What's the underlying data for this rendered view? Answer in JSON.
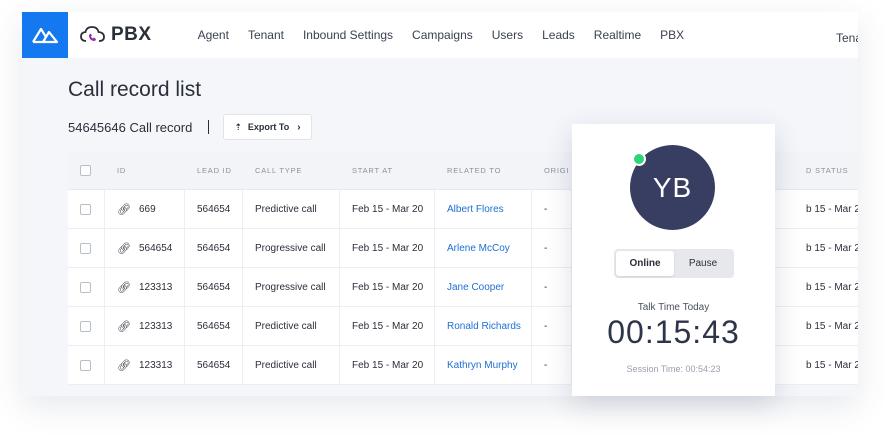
{
  "app": {
    "name": "PBX",
    "logo_icon": "triangle-mark-icon",
    "brand_icon": "cloud-phone-icon",
    "accent": "#1478f0"
  },
  "nav": {
    "items": [
      "Agent",
      "Tenant",
      "Inbound Settings",
      "Campaigns",
      "Users",
      "Leads",
      "Realtime",
      "PBX"
    ],
    "overflow_item": "Tena"
  },
  "page": {
    "title": "Call record list",
    "subtitle": "54645646 Call record",
    "export_label": "Export To"
  },
  "table": {
    "columns": [
      "ID",
      "LEAD ID",
      "CALL TYPE",
      "START AT",
      "RELATED TO",
      "ORIGI"
    ],
    "end_column": "D STATUS",
    "rows": [
      {
        "id": "669",
        "lead_id": "564654",
        "call_type": "Predictive call",
        "start_at": "Feb 15 - Mar 20",
        "related_to": "Albert Flores",
        "origin": "-",
        "end": "b 15 - Mar 20"
      },
      {
        "id": "564654",
        "lead_id": "564654",
        "call_type": "Progressive call",
        "start_at": "Feb 15 - Mar 20",
        "related_to": "Arlene McCoy",
        "origin": "-",
        "end": "b 15 - Mar 20"
      },
      {
        "id": "123313",
        "lead_id": "564654",
        "call_type": "Progressive call",
        "start_at": "Feb 15 - Mar 20",
        "related_to": "Jane Cooper",
        "origin": "-",
        "end": "b 15 - Mar 20"
      },
      {
        "id": "123313",
        "lead_id": "564654",
        "call_type": "Predictive call",
        "start_at": "Feb 15 - Mar 20",
        "related_to": "Ronald Richards",
        "origin": "-",
        "end": "b 15 - Mar 20"
      },
      {
        "id": "123313",
        "lead_id": "564654",
        "call_type": "Predictive call",
        "start_at": "Feb 15 - Mar 20",
        "related_to": "Kathryn Murphy",
        "origin": "-",
        "end": "b 15 - Mar 20"
      }
    ]
  },
  "agent_card": {
    "initials": "YB",
    "status_color": "#2ed47a",
    "online_label": "Online",
    "pause_label": "Pause",
    "talk_label": "Talk Time Today",
    "talk_time": "00:15:43",
    "session_time": "Session Time: 00:54:23"
  }
}
